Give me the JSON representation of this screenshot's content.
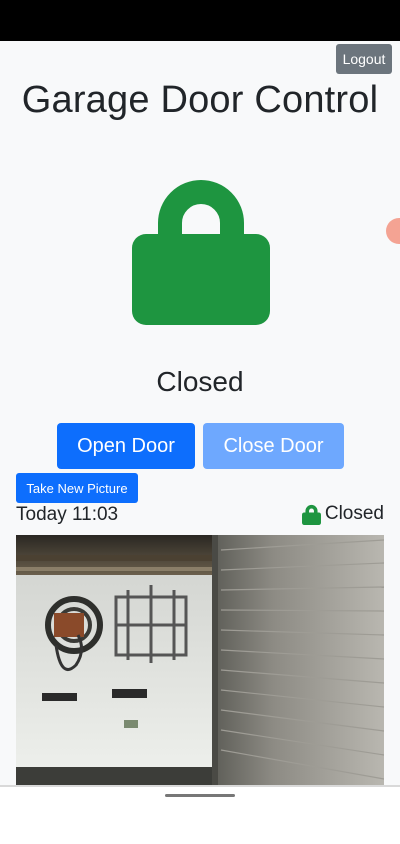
{
  "header": {
    "logout_label": "Logout"
  },
  "page": {
    "title": "Garage Door Control"
  },
  "status": {
    "door_state": "Closed",
    "state_color": "#1e9540",
    "lock_icon": "lock-icon"
  },
  "actions": {
    "open_label": "Open Door",
    "close_label": "Close Door",
    "take_picture_label": "Take New Picture"
  },
  "snapshot": {
    "timestamp": "Today 11:03",
    "door_state": "Closed"
  },
  "colors": {
    "primary": "#0d6efd",
    "primary_disabled": "#6ea8fe",
    "secondary": "#6c757d",
    "background": "#f8f9fa"
  }
}
